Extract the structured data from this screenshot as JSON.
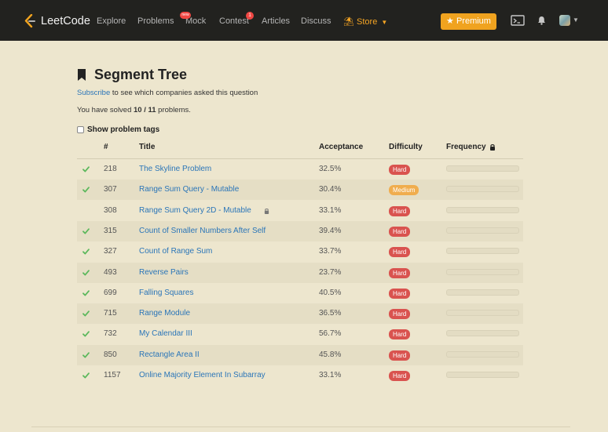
{
  "navbar": {
    "brand": "LeetCode",
    "items": [
      "Explore",
      "Problems",
      "Mock",
      "Contest",
      "Articles",
      "Discuss"
    ],
    "store_label": "Store",
    "mock_badge": "new",
    "contest_badge": "1",
    "premium_label": "Premium",
    "accent_color": "#f0a31f",
    "icons": [
      "terminal-icon",
      "bell-icon",
      "avatar"
    ]
  },
  "page": {
    "title": "Segment Tree",
    "subscribe_link": "Subscribe",
    "subscribe_rest": " to see which companies asked this question",
    "solved_prefix": "You have solved ",
    "solved_count": "10 / 11",
    "solved_suffix": " problems.",
    "show_tags_label": "Show problem tags"
  },
  "table": {
    "headers": {
      "num": "#",
      "title": "Title",
      "acceptance": "Acceptance",
      "difficulty": "Difficulty",
      "frequency": "Frequency"
    },
    "rows": [
      {
        "solved": true,
        "num": "218",
        "title": "The Skyline Problem",
        "locked": false,
        "acceptance": "32.5%",
        "difficulty": "Hard"
      },
      {
        "solved": true,
        "num": "307",
        "title": "Range Sum Query - Mutable",
        "locked": false,
        "acceptance": "30.4%",
        "difficulty": "Medium"
      },
      {
        "solved": false,
        "num": "308",
        "title": "Range Sum Query 2D - Mutable",
        "locked": true,
        "acceptance": "33.1%",
        "difficulty": "Hard"
      },
      {
        "solved": true,
        "num": "315",
        "title": "Count of Smaller Numbers After Self",
        "locked": false,
        "acceptance": "39.4%",
        "difficulty": "Hard"
      },
      {
        "solved": true,
        "num": "327",
        "title": "Count of Range Sum",
        "locked": false,
        "acceptance": "33.7%",
        "difficulty": "Hard"
      },
      {
        "solved": true,
        "num": "493",
        "title": "Reverse Pairs",
        "locked": false,
        "acceptance": "23.7%",
        "difficulty": "Hard"
      },
      {
        "solved": true,
        "num": "699",
        "title": "Falling Squares",
        "locked": false,
        "acceptance": "40.5%",
        "difficulty": "Hard"
      },
      {
        "solved": true,
        "num": "715",
        "title": "Range Module",
        "locked": false,
        "acceptance": "36.5%",
        "difficulty": "Hard"
      },
      {
        "solved": true,
        "num": "732",
        "title": "My Calendar III",
        "locked": false,
        "acceptance": "56.7%",
        "difficulty": "Hard"
      },
      {
        "solved": true,
        "num": "850",
        "title": "Rectangle Area II",
        "locked": false,
        "acceptance": "45.8%",
        "difficulty": "Hard"
      },
      {
        "solved": true,
        "num": "1157",
        "title": "Online Majority Element In Subarray",
        "locked": false,
        "acceptance": "33.1%",
        "difficulty": "Hard"
      }
    ]
  },
  "colors": {
    "hard": "#d9534f",
    "medium": "#f0ad4e",
    "link": "#2a75b8",
    "check": "#5cb85c"
  }
}
